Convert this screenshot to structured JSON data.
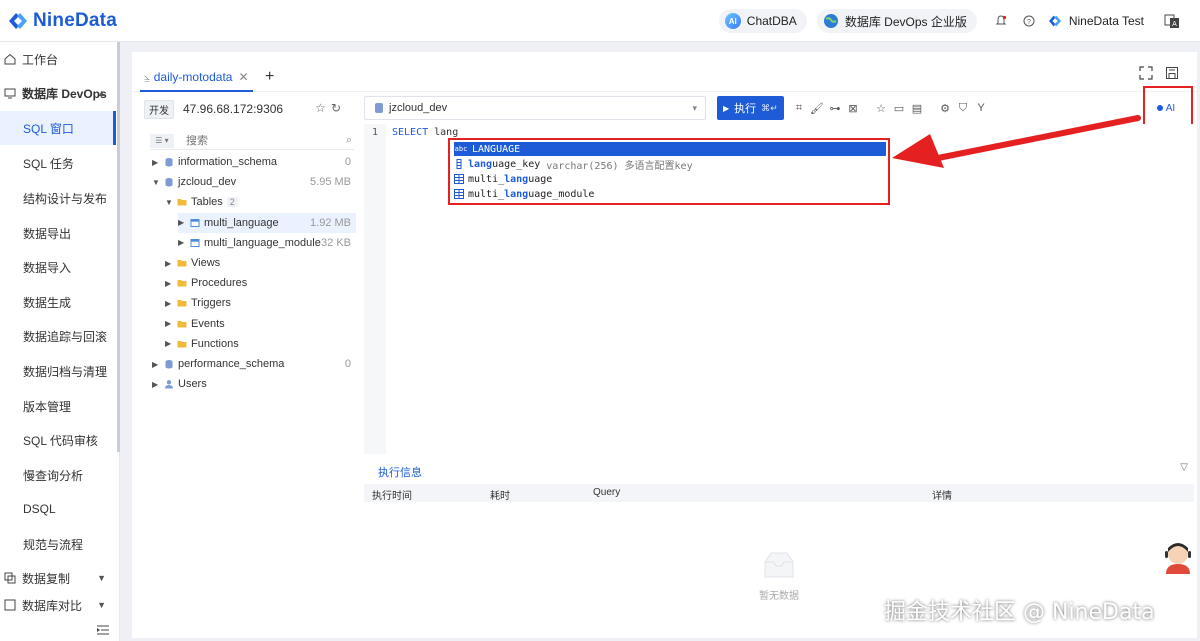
{
  "app": {
    "brand": "NineData"
  },
  "topbar": {
    "chatdba": "ChatDBA",
    "edition": "数据库 DevOps 企业版",
    "user": "NineData Test"
  },
  "sidebar": {
    "items": [
      {
        "label": "工作台",
        "kind": "top"
      },
      {
        "label": "数据库 DevOps",
        "kind": "group"
      },
      {
        "label": "SQL 窗口",
        "kind": "sub",
        "active": true
      },
      {
        "label": "SQL 任务",
        "kind": "sub"
      },
      {
        "label": "结构设计与发布",
        "kind": "sub"
      },
      {
        "label": "数据导出",
        "kind": "sub"
      },
      {
        "label": "数据导入",
        "kind": "sub"
      },
      {
        "label": "数据生成",
        "kind": "sub"
      },
      {
        "label": "数据追踪与回滚",
        "kind": "sub"
      },
      {
        "label": "数据归档与清理",
        "kind": "sub"
      },
      {
        "label": "版本管理",
        "kind": "sub"
      },
      {
        "label": "SQL 代码审核",
        "kind": "sub"
      },
      {
        "label": "慢查询分析",
        "kind": "sub"
      },
      {
        "label": "DSQL",
        "kind": "sub"
      },
      {
        "label": "规范与流程",
        "kind": "sub"
      },
      {
        "label": "数据复制",
        "kind": "group2"
      },
      {
        "label": "数据库对比",
        "kind": "group2"
      }
    ]
  },
  "tabs": [
    {
      "label": "daily-motodata"
    }
  ],
  "connection": {
    "env": "开发",
    "host": "47.96.68.172:9306"
  },
  "search": {
    "placeholder": "搜索"
  },
  "tree": [
    {
      "label": "information_schema",
      "size": "0",
      "level": 0,
      "icon": "db",
      "open": false
    },
    {
      "label": "jzcloud_dev",
      "size": "5.95 MB",
      "level": 0,
      "icon": "db",
      "open": true
    },
    {
      "label": "Tables",
      "count": "2",
      "level": 1,
      "icon": "folder",
      "open": true
    },
    {
      "label": "multi_language",
      "size": "1.92 MB",
      "level": 2,
      "icon": "table",
      "open": false,
      "selected": true
    },
    {
      "label": "multi_language_module",
      "size": "32 KB",
      "level": 2,
      "icon": "table",
      "open": false
    },
    {
      "label": "Views",
      "level": 1,
      "icon": "folder",
      "open": false
    },
    {
      "label": "Procedures",
      "level": 1,
      "icon": "folder",
      "open": false
    },
    {
      "label": "Triggers",
      "level": 1,
      "icon": "folder",
      "open": false
    },
    {
      "label": "Events",
      "level": 1,
      "icon": "folder",
      "open": false
    },
    {
      "label": "Functions",
      "level": 1,
      "icon": "folder",
      "open": false
    },
    {
      "label": "performance_schema",
      "size": "0",
      "level": 0,
      "icon": "db",
      "open": false
    },
    {
      "label": "Users",
      "level": 0,
      "icon": "user",
      "open": false
    }
  ],
  "editor": {
    "database": "jzcloud_dev",
    "run_label": "执行",
    "run_shortcut": "⌘↵",
    "ai_label": "AI",
    "line_number": "1",
    "code_keyword": "SELECT",
    "code_rest": " lang"
  },
  "suggestions": [
    {
      "icon": "abc",
      "text": "LANGUAGE",
      "match": "",
      "type": "",
      "active": true
    },
    {
      "icon": "col",
      "match": "lang",
      "rest": "uage_key",
      "type": "varchar(256) 多语言配置key"
    },
    {
      "icon": "tbl",
      "pre": "multi_",
      "match": "lang",
      "rest": "uage",
      "type": ""
    },
    {
      "icon": "tbl",
      "pre": "multi_",
      "match": "lang",
      "rest": "uage_module",
      "type": ""
    }
  ],
  "result": {
    "tab": "执行信息",
    "columns": [
      "执行时间",
      "耗时",
      "Query",
      "详情"
    ],
    "empty": "暂无数据"
  },
  "watermark": "掘金技术社区 @ NineData",
  "colors": {
    "accent": "#1d5cd6",
    "highlight": "#e52020"
  }
}
